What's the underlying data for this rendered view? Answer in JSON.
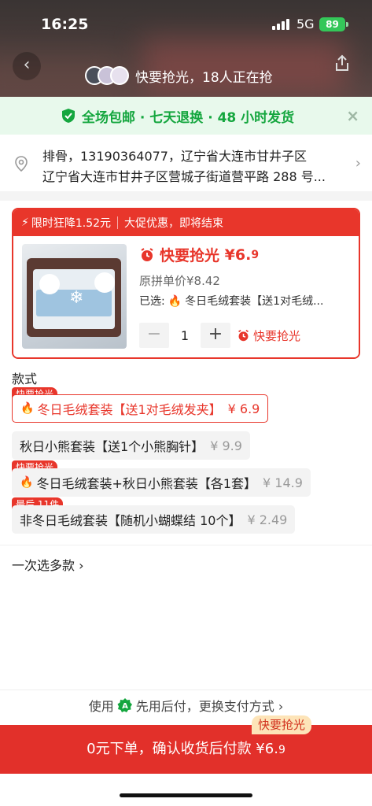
{
  "status": {
    "time": "16:25",
    "network": "5G",
    "battery": "89"
  },
  "header": {
    "notice": "快要抢光，18人正在抢"
  },
  "promise": {
    "text": "全场包邮 · 七天退换 · 48 小时发货",
    "close": "×"
  },
  "address": {
    "line1": "排骨，13190364077，辽宁省大连市甘井子区",
    "line2": "辽宁省大连市甘井子区营城子街道营平路 288 号...",
    "chevron": "›"
  },
  "promo": {
    "flash_label": "限时狂降1.52元",
    "flash_note": "大促优惠，即将结束",
    "rush_label": "快要抢光",
    "price_main": "¥6.",
    "price_decimal": "9",
    "original_price": "原拼单价¥8.42",
    "selected_prefix": "已选:",
    "selected_value": "冬日毛绒套装【送1对毛绒...",
    "quantity": "1",
    "minus": "−",
    "plus": "+",
    "stepper_rush": "快要抢光"
  },
  "variants": {
    "title": "款式",
    "items": [
      {
        "tag": "快要抢光",
        "label": "冬日毛绒套装【送1对毛绒发夹】",
        "price": "¥ 6.9",
        "selected": true
      },
      {
        "tag": "",
        "label": "秋日小熊套装【送1个小熊胸针】",
        "price": "¥ 9.9",
        "selected": false
      },
      {
        "tag": "快要抢光",
        "label": "冬日毛绒套装+秋日小熊套装【各1套】",
        "price": "¥ 14.9",
        "selected": false
      },
      {
        "tag": "最后 11件",
        "label": "非冬日毛绒套装【随机小蝴蝶结 10个】",
        "price": "¥ 2.49",
        "selected": false
      }
    ],
    "multi": "一次选多款 ›"
  },
  "payment": {
    "prefix": "使用",
    "method": "先用后付，更换支付方式 ›",
    "order_text": "0元下单，确认收货后付款 ¥6.",
    "order_decimal": "9",
    "order_tag": "快要抢光"
  },
  "colors": {
    "accent": "#e8362b",
    "green": "#14a63e"
  }
}
